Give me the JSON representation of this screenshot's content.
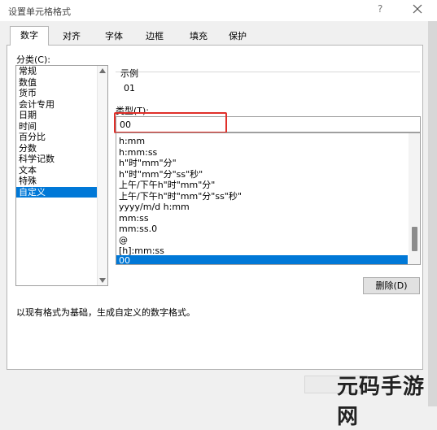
{
  "window": {
    "title": "设置单元格格式",
    "help_glyph": "?"
  },
  "tabs": [
    {
      "label": "数字"
    },
    {
      "label": "对齐"
    },
    {
      "label": "字体"
    },
    {
      "label": "边框"
    },
    {
      "label": "填充"
    },
    {
      "label": "保护"
    }
  ],
  "category": {
    "label": "分类(C):",
    "items": [
      "常规",
      "数值",
      "货币",
      "会计专用",
      "日期",
      "时间",
      "百分比",
      "分数",
      "科学记数",
      "文本",
      "特殊",
      "自定义"
    ],
    "selected": "自定义"
  },
  "sample": {
    "label": "示例",
    "value": "01"
  },
  "type": {
    "label": "类型(T):",
    "value": "00",
    "list": [
      "h:mm",
      "h:mm:ss",
      "h\"时\"mm\"分\"",
      "h\"时\"mm\"分\"ss\"秒\"",
      "上午/下午h\"时\"mm\"分\"",
      "上午/下午h\"时\"mm\"分\"ss\"秒\"",
      "yyyy/m/d h:mm",
      "mm:ss",
      "mm:ss.0",
      "@",
      "[h]:mm:ss",
      "00"
    ],
    "selected": "00"
  },
  "delete_button": "删除(D)",
  "hint": "以现有格式为基础，生成自定义的数字格式。",
  "watermark": "元码手游网"
}
